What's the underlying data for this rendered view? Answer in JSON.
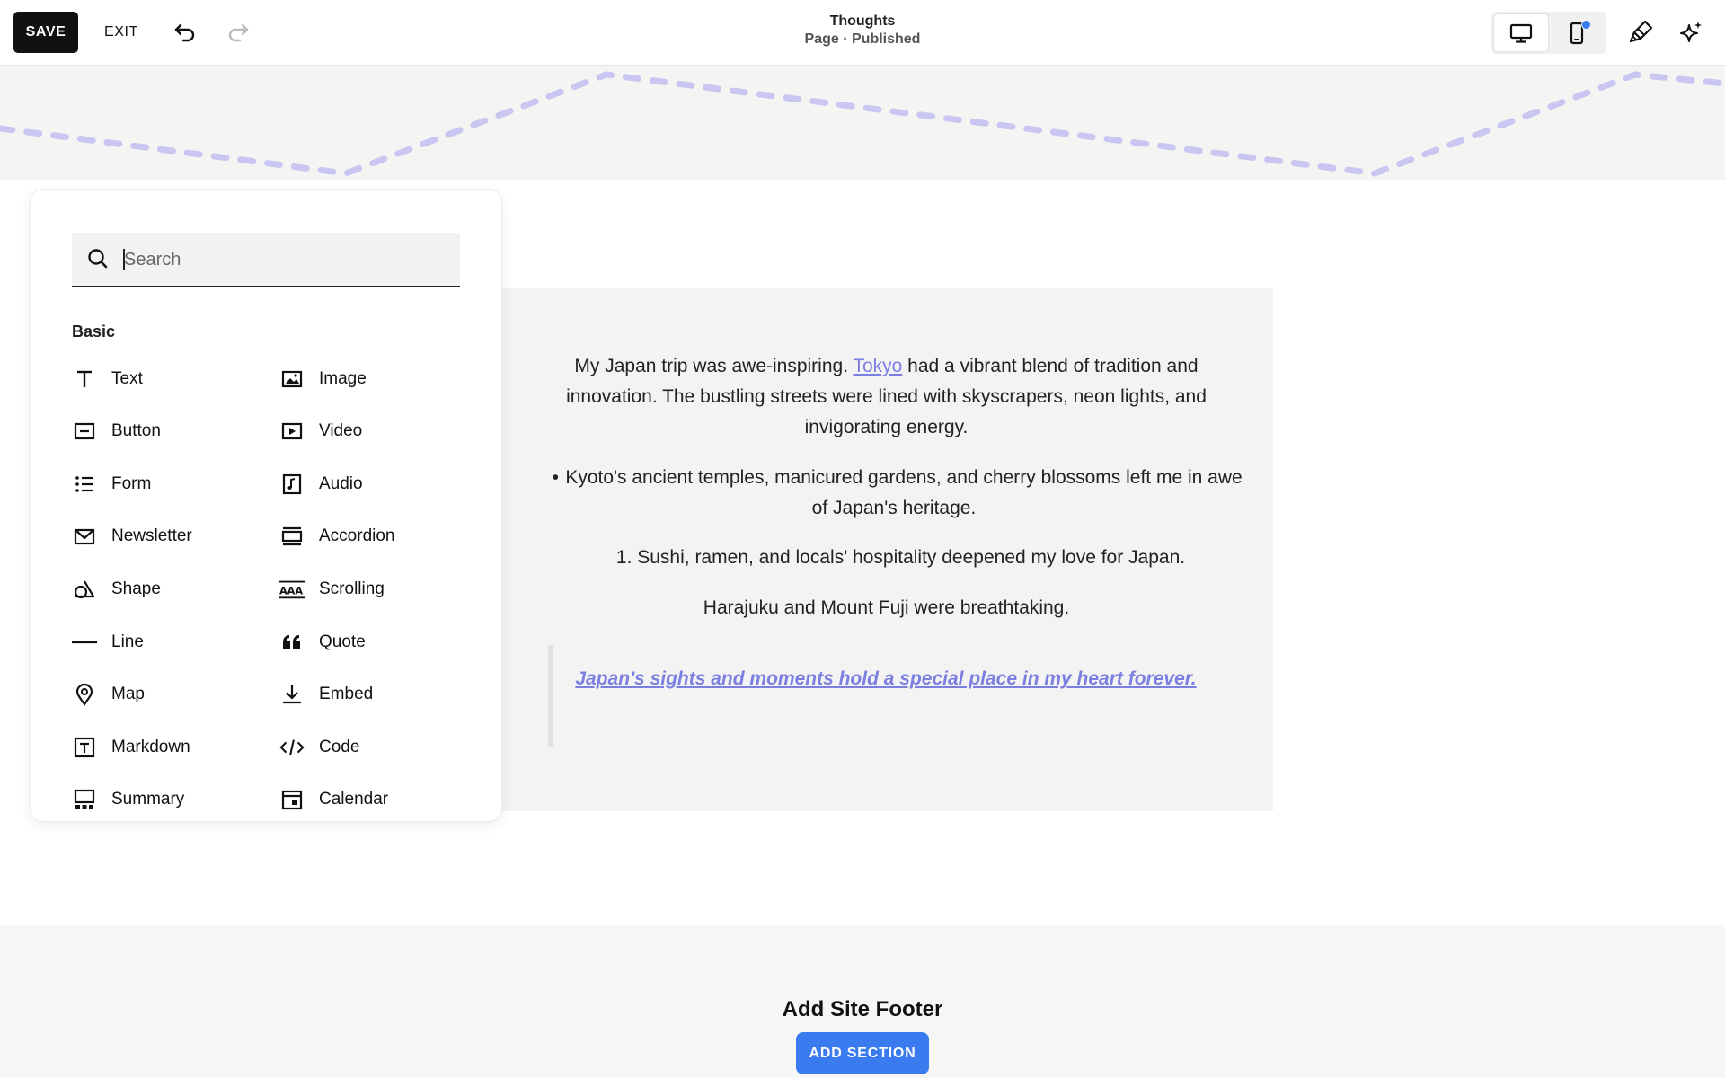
{
  "toolbar": {
    "save_label": "SAVE",
    "exit_label": "EXIT",
    "page_title": "Thoughts",
    "page_subtitle": "Page · Published"
  },
  "content": {
    "para1_before": "My Japan trip was awe-inspiring. ",
    "para1_link": "Tokyo",
    "para1_after": " had a vibrant blend of tradition and innovation. The bustling streets were lined with skyscrapers, neon lights, and invigorating energy.",
    "bullet_marker": "•",
    "bullet_text": "Kyoto's ancient temples, manicured gardens, and cherry blossoms left me in awe of Japan's heritage.",
    "numbered_text": "1. Sushi, ramen, and locals' hospitality deepened my love for Japan.",
    "para4": "Harajuku and Mount Fuji were breathtaking.",
    "quote": "Japan's sights and moments hold a special place in my heart forever."
  },
  "footer": {
    "title": "Add Site Footer",
    "button_label": "ADD SECTION"
  },
  "panel": {
    "search_placeholder": "Search",
    "section_label": "Basic",
    "left_items": [
      {
        "label": "Text",
        "icon": "text-icon"
      },
      {
        "label": "Button",
        "icon": "button-icon"
      },
      {
        "label": "Form",
        "icon": "form-icon"
      },
      {
        "label": "Newsletter",
        "icon": "newsletter-icon"
      },
      {
        "label": "Shape",
        "icon": "shape-icon"
      },
      {
        "label": "Line",
        "icon": "line-icon"
      },
      {
        "label": "Map",
        "icon": "map-icon"
      },
      {
        "label": "Markdown",
        "icon": "markdown-icon"
      },
      {
        "label": "Summary",
        "icon": "summary-icon"
      }
    ],
    "right_items": [
      {
        "label": "Image",
        "icon": "image-icon"
      },
      {
        "label": "Video",
        "icon": "video-icon"
      },
      {
        "label": "Audio",
        "icon": "audio-icon"
      },
      {
        "label": "Accordion",
        "icon": "accordion-icon"
      },
      {
        "label": "Scrolling",
        "icon": "scrolling-icon"
      },
      {
        "label": "Quote",
        "icon": "quote-icon"
      },
      {
        "label": "Embed",
        "icon": "embed-icon"
      },
      {
        "label": "Code",
        "icon": "code-icon"
      },
      {
        "label": "Calendar",
        "icon": "calendar-icon"
      }
    ]
  },
  "colors": {
    "accent_link": "#7b7fe0",
    "primary_button": "#3a7bf0",
    "wave_dots": "#c9c6f2"
  }
}
